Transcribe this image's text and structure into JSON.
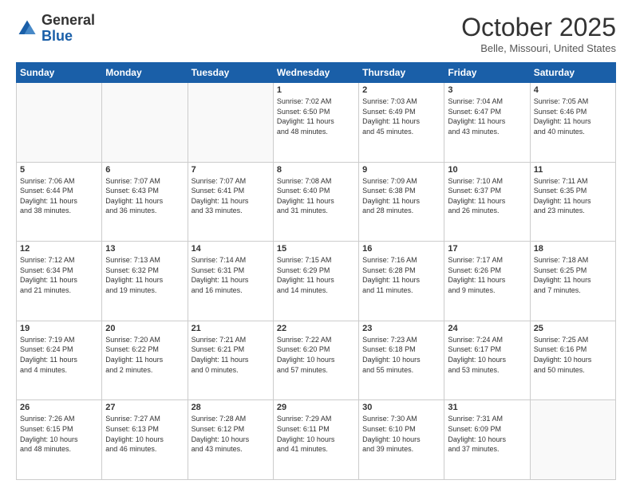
{
  "header": {
    "logo_general": "General",
    "logo_blue": "Blue",
    "month_title": "October 2025",
    "location": "Belle, Missouri, United States"
  },
  "days_of_week": [
    "Sunday",
    "Monday",
    "Tuesday",
    "Wednesday",
    "Thursday",
    "Friday",
    "Saturday"
  ],
  "weeks": [
    [
      {
        "day": "",
        "info": ""
      },
      {
        "day": "",
        "info": ""
      },
      {
        "day": "",
        "info": ""
      },
      {
        "day": "1",
        "info": "Sunrise: 7:02 AM\nSunset: 6:50 PM\nDaylight: 11 hours\nand 48 minutes."
      },
      {
        "day": "2",
        "info": "Sunrise: 7:03 AM\nSunset: 6:49 PM\nDaylight: 11 hours\nand 45 minutes."
      },
      {
        "day": "3",
        "info": "Sunrise: 7:04 AM\nSunset: 6:47 PM\nDaylight: 11 hours\nand 43 minutes."
      },
      {
        "day": "4",
        "info": "Sunrise: 7:05 AM\nSunset: 6:46 PM\nDaylight: 11 hours\nand 40 minutes."
      }
    ],
    [
      {
        "day": "5",
        "info": "Sunrise: 7:06 AM\nSunset: 6:44 PM\nDaylight: 11 hours\nand 38 minutes."
      },
      {
        "day": "6",
        "info": "Sunrise: 7:07 AM\nSunset: 6:43 PM\nDaylight: 11 hours\nand 36 minutes."
      },
      {
        "day": "7",
        "info": "Sunrise: 7:07 AM\nSunset: 6:41 PM\nDaylight: 11 hours\nand 33 minutes."
      },
      {
        "day": "8",
        "info": "Sunrise: 7:08 AM\nSunset: 6:40 PM\nDaylight: 11 hours\nand 31 minutes."
      },
      {
        "day": "9",
        "info": "Sunrise: 7:09 AM\nSunset: 6:38 PM\nDaylight: 11 hours\nand 28 minutes."
      },
      {
        "day": "10",
        "info": "Sunrise: 7:10 AM\nSunset: 6:37 PM\nDaylight: 11 hours\nand 26 minutes."
      },
      {
        "day": "11",
        "info": "Sunrise: 7:11 AM\nSunset: 6:35 PM\nDaylight: 11 hours\nand 23 minutes."
      }
    ],
    [
      {
        "day": "12",
        "info": "Sunrise: 7:12 AM\nSunset: 6:34 PM\nDaylight: 11 hours\nand 21 minutes."
      },
      {
        "day": "13",
        "info": "Sunrise: 7:13 AM\nSunset: 6:32 PM\nDaylight: 11 hours\nand 19 minutes."
      },
      {
        "day": "14",
        "info": "Sunrise: 7:14 AM\nSunset: 6:31 PM\nDaylight: 11 hours\nand 16 minutes."
      },
      {
        "day": "15",
        "info": "Sunrise: 7:15 AM\nSunset: 6:29 PM\nDaylight: 11 hours\nand 14 minutes."
      },
      {
        "day": "16",
        "info": "Sunrise: 7:16 AM\nSunset: 6:28 PM\nDaylight: 11 hours\nand 11 minutes."
      },
      {
        "day": "17",
        "info": "Sunrise: 7:17 AM\nSunset: 6:26 PM\nDaylight: 11 hours\nand 9 minutes."
      },
      {
        "day": "18",
        "info": "Sunrise: 7:18 AM\nSunset: 6:25 PM\nDaylight: 11 hours\nand 7 minutes."
      }
    ],
    [
      {
        "day": "19",
        "info": "Sunrise: 7:19 AM\nSunset: 6:24 PM\nDaylight: 11 hours\nand 4 minutes."
      },
      {
        "day": "20",
        "info": "Sunrise: 7:20 AM\nSunset: 6:22 PM\nDaylight: 11 hours\nand 2 minutes."
      },
      {
        "day": "21",
        "info": "Sunrise: 7:21 AM\nSunset: 6:21 PM\nDaylight: 11 hours\nand 0 minutes."
      },
      {
        "day": "22",
        "info": "Sunrise: 7:22 AM\nSunset: 6:20 PM\nDaylight: 10 hours\nand 57 minutes."
      },
      {
        "day": "23",
        "info": "Sunrise: 7:23 AM\nSunset: 6:18 PM\nDaylight: 10 hours\nand 55 minutes."
      },
      {
        "day": "24",
        "info": "Sunrise: 7:24 AM\nSunset: 6:17 PM\nDaylight: 10 hours\nand 53 minutes."
      },
      {
        "day": "25",
        "info": "Sunrise: 7:25 AM\nSunset: 6:16 PM\nDaylight: 10 hours\nand 50 minutes."
      }
    ],
    [
      {
        "day": "26",
        "info": "Sunrise: 7:26 AM\nSunset: 6:15 PM\nDaylight: 10 hours\nand 48 minutes."
      },
      {
        "day": "27",
        "info": "Sunrise: 7:27 AM\nSunset: 6:13 PM\nDaylight: 10 hours\nand 46 minutes."
      },
      {
        "day": "28",
        "info": "Sunrise: 7:28 AM\nSunset: 6:12 PM\nDaylight: 10 hours\nand 43 minutes."
      },
      {
        "day": "29",
        "info": "Sunrise: 7:29 AM\nSunset: 6:11 PM\nDaylight: 10 hours\nand 41 minutes."
      },
      {
        "day": "30",
        "info": "Sunrise: 7:30 AM\nSunset: 6:10 PM\nDaylight: 10 hours\nand 39 minutes."
      },
      {
        "day": "31",
        "info": "Sunrise: 7:31 AM\nSunset: 6:09 PM\nDaylight: 10 hours\nand 37 minutes."
      },
      {
        "day": "",
        "info": ""
      }
    ]
  ]
}
